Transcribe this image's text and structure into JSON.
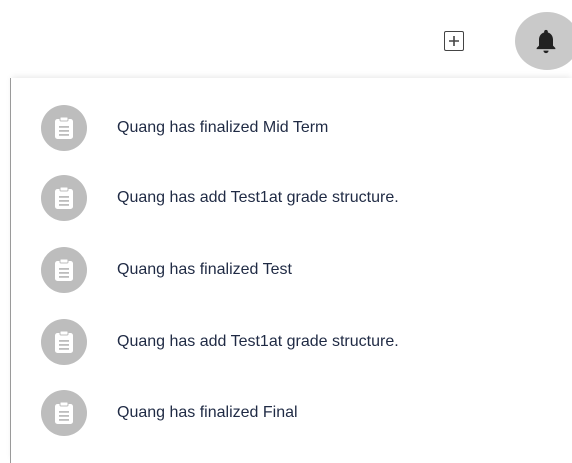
{
  "header": {
    "add_icon": "plus-square-icon",
    "bell_icon": "bell-icon"
  },
  "notifications": {
    "icon": "clipboard-icon",
    "items": [
      {
        "text": "Quang has finalized Mid Term"
      },
      {
        "text": "Quang has add Test1at grade structure."
      },
      {
        "text": "Quang has finalized Test"
      },
      {
        "text": "Quang has add Test1at grade structure."
      },
      {
        "text": "Quang has finalized Final"
      }
    ]
  },
  "colors": {
    "avatar_bg": "#bdbdbd",
    "bell_bg": "#c9c9c9",
    "text": "#1f2a44"
  }
}
